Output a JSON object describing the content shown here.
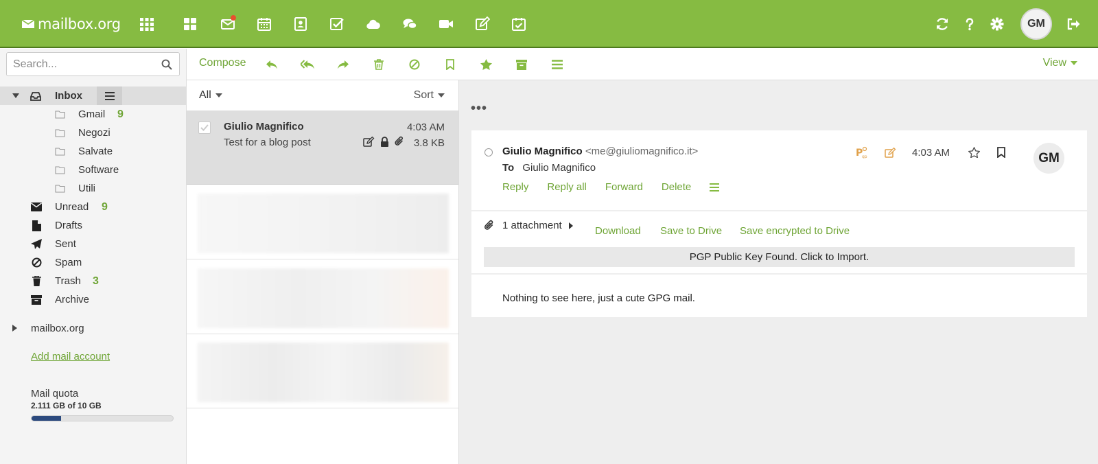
{
  "app": {
    "logo_text": "mailbox.org",
    "avatar_initials": "GM"
  },
  "topbar": {
    "apps": [
      "apps-grid-icon",
      "dashboard-icon",
      "mail-icon",
      "calendar-icon",
      "contacts-icon",
      "tasks-icon",
      "cloud-icon",
      "chat-icon",
      "video-icon",
      "notes-icon",
      "calendar-check-icon"
    ],
    "right": [
      "refresh-icon",
      "help-icon",
      "settings-icon",
      "logout-icon"
    ],
    "notification_color": "#e8502f"
  },
  "search": {
    "placeholder": "Search..."
  },
  "folders": {
    "inbox": {
      "label": "Inbox"
    },
    "subfolders": [
      {
        "label": "Gmail",
        "count": "9"
      },
      {
        "label": "Negozi",
        "count": ""
      },
      {
        "label": "Salvate",
        "count": ""
      },
      {
        "label": "Software",
        "count": ""
      },
      {
        "label": "Utili",
        "count": ""
      }
    ],
    "standard": [
      {
        "label": "Unread",
        "count": "9",
        "icon": "envelope-icon"
      },
      {
        "label": "Drafts",
        "count": "",
        "icon": "drafts-icon"
      },
      {
        "label": "Sent",
        "count": "",
        "icon": "sent-icon"
      },
      {
        "label": "Spam",
        "count": "",
        "icon": "spam-icon"
      },
      {
        "label": "Trash",
        "count": "3",
        "icon": "trash-icon"
      },
      {
        "label": "Archive",
        "count": "",
        "icon": "archive-icon"
      }
    ],
    "account": "mailbox.org",
    "add_account": "Add mail account"
  },
  "quota": {
    "label": "Mail quota",
    "value": "2.111 GB of 10 GB",
    "fraction": 0.2111
  },
  "toolbar": {
    "compose": "Compose",
    "view": "View"
  },
  "list": {
    "filter": "All",
    "sort": "Sort",
    "items": [
      {
        "from": "Giulio Magnifico",
        "subject": "Test for a blog post",
        "time": "4:03 AM",
        "size": "3.8 KB"
      }
    ]
  },
  "mail": {
    "from_name": "Giulio Magnifico",
    "from_addr": "<me@giuliomagnifico.it>",
    "to_label": "To",
    "to": "Giulio Magnifico",
    "time": "4:03 AM",
    "avatar": "GM",
    "actions": [
      "Reply",
      "Reply all",
      "Forward",
      "Delete"
    ],
    "attachments": "1 attachment",
    "download": "Download",
    "save_drive": "Save to Drive",
    "save_encrypted": "Save encrypted to Drive",
    "pgp_notice": "PGP Public Key Found. Click to Import.",
    "body": "Nothing to see here, just a cute GPG mail."
  },
  "colors": {
    "brand": "#86bb42",
    "accent_text": "#6fa536",
    "quota_fill": "#2c4a7e"
  }
}
